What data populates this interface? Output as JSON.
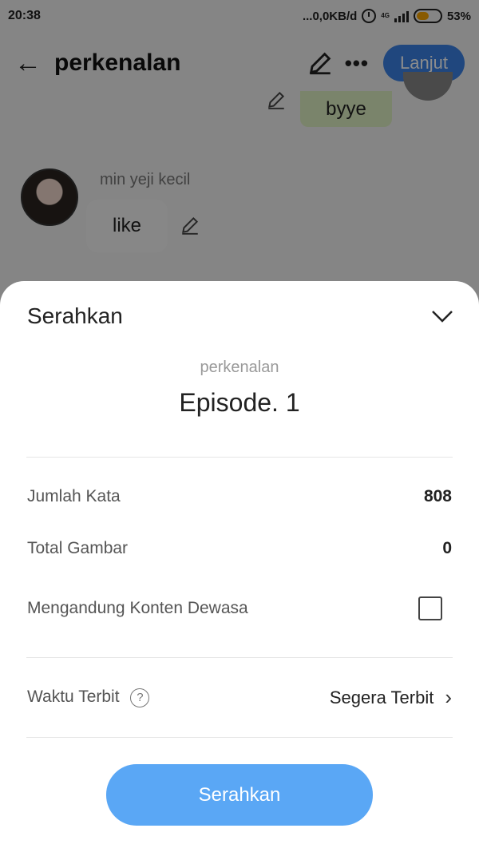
{
  "status_bar": {
    "time": "20:38",
    "network_speed": "...0,0KB/d",
    "network_type": "4G",
    "battery_percent": "53%",
    "battery_level": 0.53
  },
  "app_bar": {
    "back_icon": "arrow-left",
    "title": "perkenalan",
    "edit_icon": "pencil",
    "more_icon": "more-horizontal",
    "more_label": "•••",
    "next_button_label": "Lanjut"
  },
  "chat": {
    "right_message": "byye",
    "left_sender_name": "min yeji kecil",
    "left_message": "like"
  },
  "sheet": {
    "title": "Serahkan",
    "collapse_icon": "chevron-down",
    "story_name": "perkenalan",
    "episode_label": "Episode. 1",
    "rows": {
      "word_count_label": "Jumlah Kata",
      "word_count_value": "808",
      "image_count_label": "Total Gambar",
      "image_count_value": "0",
      "adult_content_label": "Mengandung Konten Dewasa",
      "adult_content_checked": false,
      "publish_time_label": "Waktu Terbit",
      "help_icon_label": "?",
      "publish_time_value": "Segera Terbit",
      "chevron_label": "›"
    },
    "submit_label": "Serahkan"
  },
  "colors": {
    "primary_button": "#5aa7f5",
    "app_bar_button": "#3b82e6",
    "right_bubble": "#dff0c3",
    "overlay": "rgba(0,0,0,0.45)"
  }
}
